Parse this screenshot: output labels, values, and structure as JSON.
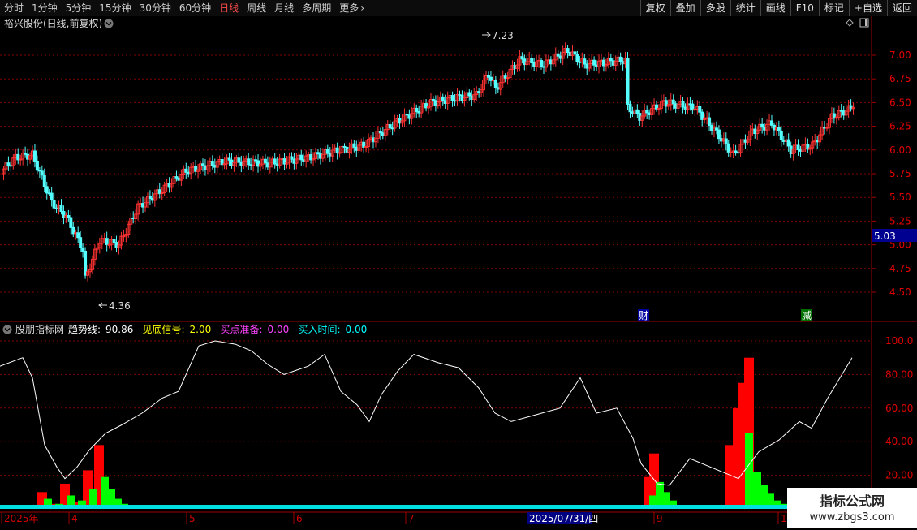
{
  "toolbar": {
    "periods": [
      "分时",
      "1分钟",
      "5分钟",
      "15分钟",
      "30分钟",
      "60分钟",
      "日线",
      "周线",
      "月线",
      "多周期",
      "更多"
    ],
    "active_period": "日线",
    "more_arrow": "›",
    "right_buttons": [
      "复权",
      "叠加",
      "多股",
      "统计",
      "画线",
      "F10",
      "标记",
      "+自选",
      "返回"
    ]
  },
  "stock": {
    "title": "裕兴股份(日线,前复权)"
  },
  "price_axis": {
    "ticks": [
      "7.00",
      "6.75",
      "6.50",
      "6.25",
      "6.00",
      "5.75",
      "5.50",
      "5.25",
      "5.00",
      "4.75",
      "4.50"
    ]
  },
  "current_price": "5.03",
  "annotations": {
    "high": "7.23",
    "low": "4.36",
    "marker_cai": "财",
    "marker_jian": "减"
  },
  "indicator": {
    "name": "股朋指标网",
    "fields": [
      {
        "label": "趋势线:",
        "value": "90.86",
        "color": "#ffffff"
      },
      {
        "label": "见底信号:",
        "value": "2.00",
        "color": "#ffff00"
      },
      {
        "label": "买点准备:",
        "value": "0.00",
        "color": "#ff44ff"
      },
      {
        "label": "买入时间:",
        "value": "0.00",
        "color": "#00ffff"
      }
    ],
    "ticks": [
      "100.0",
      "80.00",
      "60.00",
      "40.00",
      "20.00"
    ]
  },
  "date_axis": {
    "labels": [
      "2025年",
      "4",
      "5",
      "6",
      "7",
      "9",
      "10"
    ],
    "cursor": "2025/07/31/四"
  },
  "watermark": {
    "title": "指标公式网",
    "url": "www.zbgs3.com"
  },
  "colors": {
    "up": "#ff3232",
    "down": "#54ffff",
    "grid": "#800000",
    "axis": "#a00000",
    "trend": "#ffffff",
    "red_bar": "#ff0000",
    "green_bar": "#00ff00"
  }
}
